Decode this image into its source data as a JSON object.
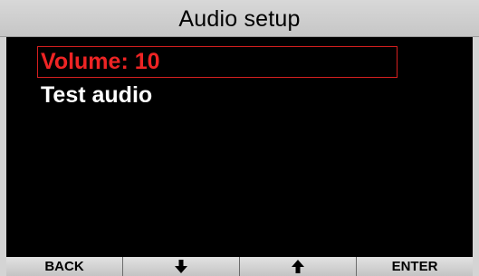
{
  "title": "Audio setup",
  "menu": {
    "items": [
      {
        "label": "Volume: 10",
        "selected": true
      },
      {
        "label": "Test audio",
        "selected": false
      }
    ]
  },
  "softkeys": {
    "back": "BACK",
    "down_icon": "arrow-down-icon",
    "up_icon": "arrow-up-icon",
    "enter": "ENTER"
  },
  "colors": {
    "selected_text": "#ee2424",
    "selected_border": "#d51f1f",
    "normal_text": "#ffffff",
    "background": "#000000",
    "bar": "#d4d4d4"
  }
}
